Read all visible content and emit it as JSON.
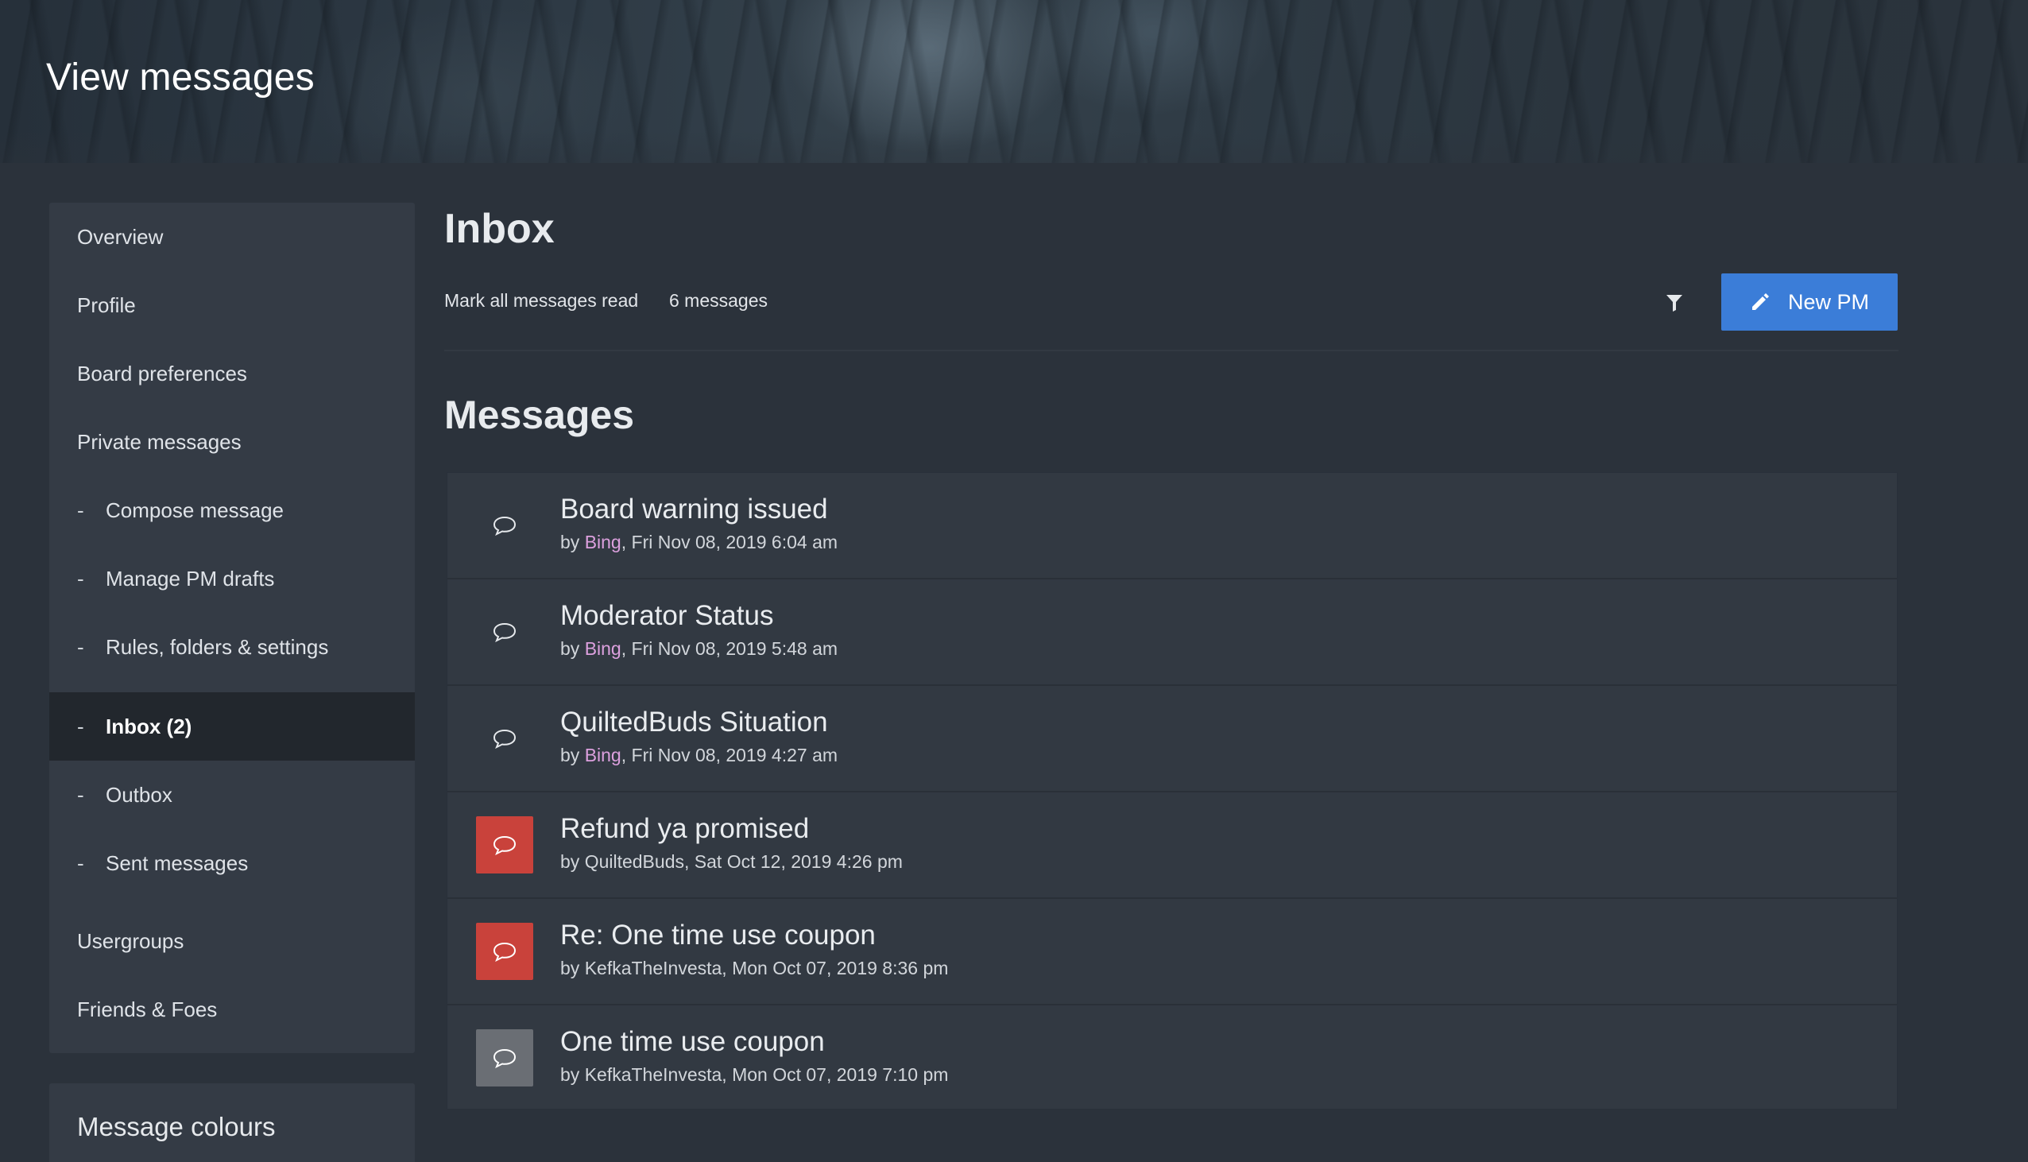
{
  "header": {
    "title": "View messages"
  },
  "sidebar": {
    "items": [
      {
        "label": "Overview",
        "sub": false,
        "active": false
      },
      {
        "label": "Profile",
        "sub": false,
        "active": false
      },
      {
        "label": "Board preferences",
        "sub": false,
        "active": false
      },
      {
        "label": "Private messages",
        "sub": false,
        "active": false
      },
      {
        "label": "Compose message",
        "sub": true,
        "active": false
      },
      {
        "label": "Manage PM drafts",
        "sub": true,
        "active": false
      },
      {
        "label": "Rules, folders & settings",
        "sub": true,
        "active": false
      },
      {
        "label": "Inbox (2)",
        "sub": true,
        "active": true
      },
      {
        "label": "Outbox",
        "sub": true,
        "active": false
      },
      {
        "label": "Sent messages",
        "sub": true,
        "active": false
      },
      {
        "label": "Usergroups",
        "sub": false,
        "active": false
      },
      {
        "label": "Friends & Foes",
        "sub": false,
        "active": false
      }
    ],
    "dash": "-",
    "colours_title": "Message colours"
  },
  "main": {
    "title": "Inbox",
    "mark_read": "Mark all messages read",
    "count": "6 messages",
    "new_pm_label": "New PM",
    "section_title": "Messages"
  },
  "messages": [
    {
      "subject": "Board warning issued",
      "by": "by ",
      "author": "Bing",
      "date": ", Fri Nov 08, 2019 6:04 am",
      "status": "read",
      "author_colored": true
    },
    {
      "subject": "Moderator Status",
      "by": "by ",
      "author": "Bing",
      "date": ", Fri Nov 08, 2019 5:48 am",
      "status": "read",
      "author_colored": true
    },
    {
      "subject": "QuiltedBuds Situation",
      "by": "by ",
      "author": "Bing",
      "date": ", Fri Nov 08, 2019 4:27 am",
      "status": "read",
      "author_colored": true
    },
    {
      "subject": "Refund ya promised",
      "by": "by ",
      "author": "QuiltedBuds",
      "date": ", Sat Oct 12, 2019 4:26 pm",
      "status": "unread",
      "author_colored": false
    },
    {
      "subject": "Re: One time use coupon",
      "by": "by ",
      "author": "KefkaTheInvesta",
      "date": ", Mon Oct 07, 2019 8:36 pm",
      "status": "unread",
      "author_colored": false
    },
    {
      "subject": "One time use coupon",
      "by": "by ",
      "author": "KefkaTheInvesta",
      "date": ", Mon Oct 07, 2019 7:10 pm",
      "status": "replied",
      "author_colored": false
    }
  ],
  "colors": {
    "accent": "#3b7dd8",
    "unread": "#c9423b",
    "replied": "#6a6e74",
    "author_highlight": "#dca0de"
  },
  "icons": {
    "message": "speech-bubble-icon",
    "filter": "filter-icon",
    "pencil": "pencil-icon"
  }
}
